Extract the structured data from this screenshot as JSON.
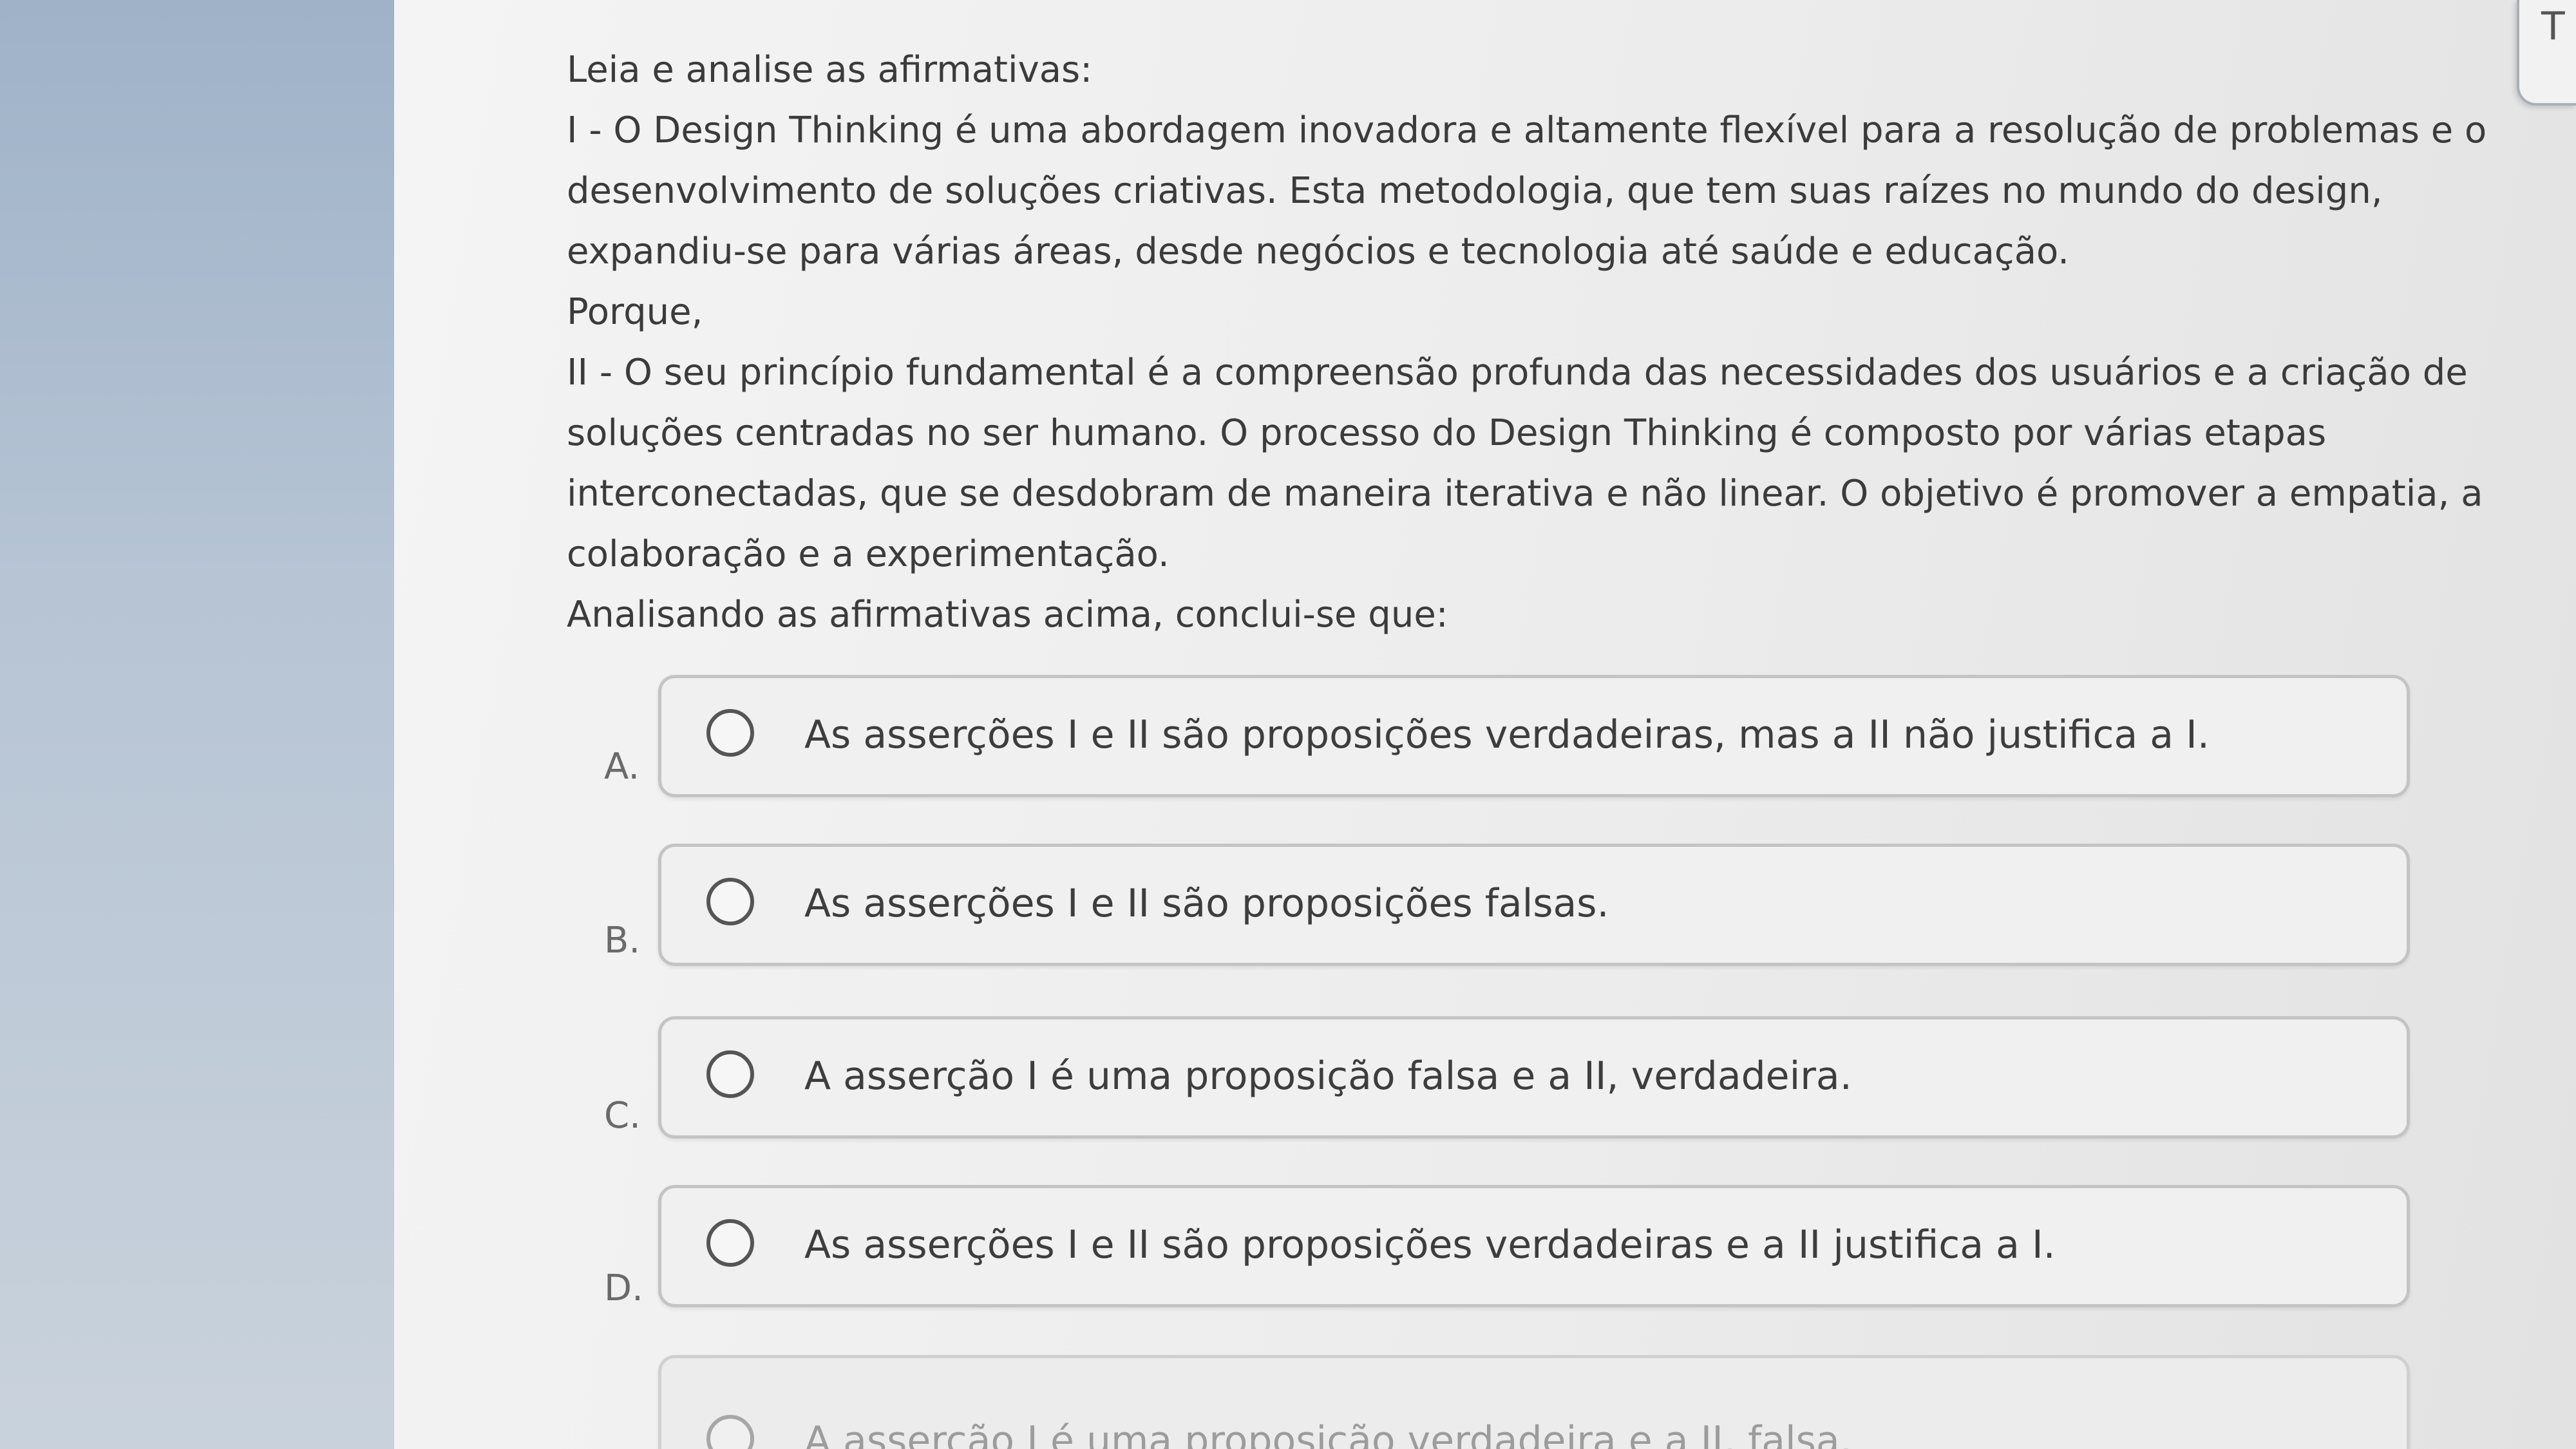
{
  "corner_tab": {
    "label": "T"
  },
  "question": {
    "intro": "Leia e analise as afirmativas:",
    "lines": [
      "I - O Design Thinking é uma abordagem inovadora e altamente flexível para a resolução de problemas e o",
      "desenvolvimento de soluções criativas. Esta metodologia, que tem suas raízes no mundo do design,",
      "expandiu-se para várias áreas, desde negócios e tecnologia até saúde e educação.",
      "Porque,",
      "II - O seu princípio fundamental é a compreensão profunda das necessidades dos usuários e a criação de",
      "soluções centradas no ser humano. O processo do Design Thinking é composto por várias etapas",
      "interconectadas, que se desdobram de maneira iterativa e não linear. O objetivo é promover a empatia, a",
      "colaboração e a experimentação.",
      "Analisando as afirmativas acima, conclui-se que:"
    ]
  },
  "options": [
    {
      "letter": "A.",
      "text": "As asserções I e II são proposições verdadeiras, mas a II não justifica a I."
    },
    {
      "letter": "B.",
      "text": "As asserções I e II são proposições falsas."
    },
    {
      "letter": "C.",
      "text": "A asserção I é uma proposição falsa e a II, verdadeira."
    },
    {
      "letter": "D.",
      "text": "As asserções I e II são proposições verdadeiras e a II justifica a I."
    },
    {
      "letter": "",
      "text": "A asserção I é uma proposição verdadeira e a II, falsa."
    }
  ]
}
